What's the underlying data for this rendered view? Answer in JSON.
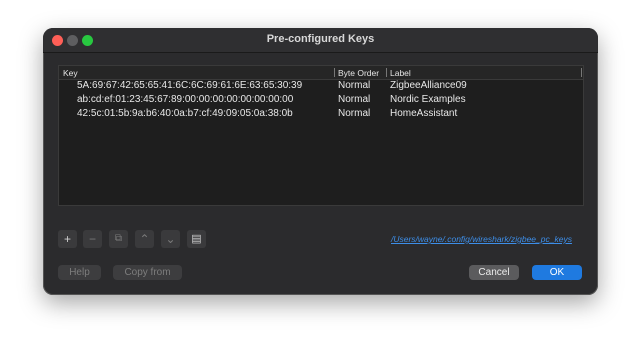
{
  "window": {
    "title": "Pre-configured Keys"
  },
  "table": {
    "headers": {
      "key": "Key",
      "byte_order": "Byte Order",
      "label": "Label"
    },
    "rows": [
      {
        "key": "5A:69:67:42:65:65:41:6C:6C:69:61:6E:63:65:30:39",
        "byte_order": "Normal",
        "label": "ZigbeeAlliance09"
      },
      {
        "key": "ab:cd:ef:01:23:45:67:89:00:00:00:00:00:00:00:00",
        "byte_order": "Normal",
        "label": "Nordic Examples"
      },
      {
        "key": "42:5c:01:5b:9a:b6:40:0a:b7:cf:49:09:05:0a:38:0b",
        "byte_order": "Normal",
        "label": "HomeAssistant"
      }
    ]
  },
  "toolbar": {
    "add_icon": "+",
    "remove_icon": "−",
    "copy_icon": "⧉",
    "up_icon": "⌃",
    "down_icon": "⌄",
    "open_icon": "▤"
  },
  "path_link": "/Users/wayne/.config/wireshark/zigbee_pc_keys",
  "buttons": {
    "help": "Help",
    "copy_from": "Copy from",
    "cancel": "Cancel",
    "ok": "OK"
  }
}
